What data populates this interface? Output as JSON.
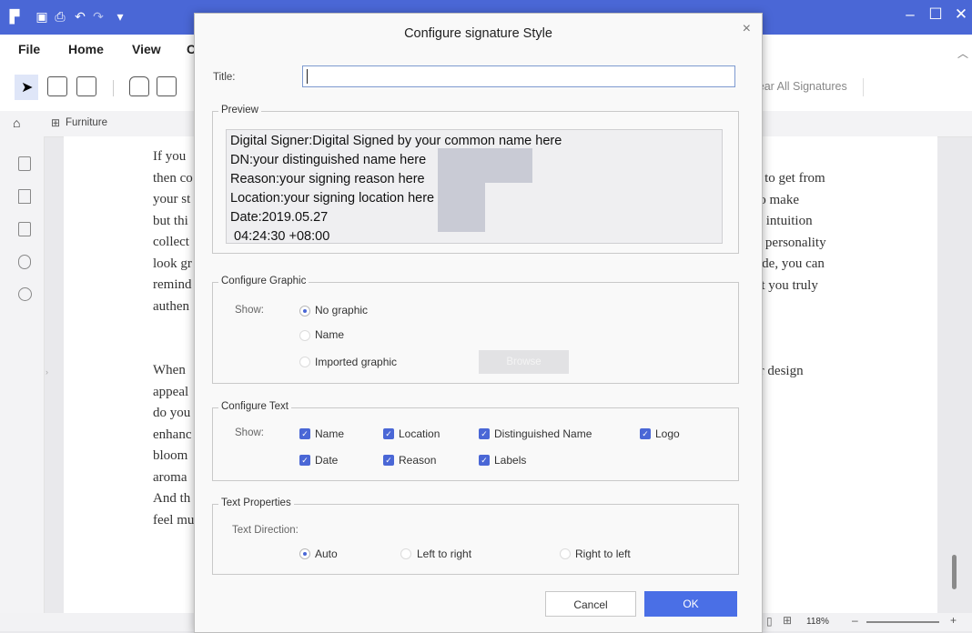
{
  "app": {
    "menu": [
      "File",
      "Home",
      "View",
      "C"
    ],
    "toolbar_right_label": "lear All Signatures",
    "tab_label": "Furniture",
    "zoom": "118%",
    "doc_left_lines": [
      "If you",
      "then co",
      "your st",
      "but thi",
      "collect",
      "look gr",
      "remind",
      "authen",
      "",
      "",
      "When",
      "appeal",
      "do you",
      "enhanc",
      "bloom",
      "aroma",
      "And th",
      "feel mu"
    ],
    "doc_right_lines": [
      "ant to get from",
      "it to make",
      "our intuition",
      "ing personality",
      "guide, you can",
      "that you truly",
      "",
      "",
      "",
      "rior design"
    ]
  },
  "dialog": {
    "title": "Configure signature Style",
    "close": "×",
    "title_field_label": "Title:",
    "title_value": "",
    "preview": {
      "legend": "Preview",
      "lines": [
        "Digital Signer:Digital Signed by your common name here",
        "DN:your distinguished name here",
        "Reason:your signing reason here",
        "Location:your signing location here",
        "Date:2019.05.27",
        " 04:24:30 +08:00"
      ]
    },
    "graphic": {
      "legend": "Configure Graphic",
      "show_label": "Show:",
      "options": [
        "No graphic",
        "Name",
        "Imported graphic"
      ],
      "selected": "No graphic",
      "browse": "Browse"
    },
    "text": {
      "legend": "Configure Text",
      "show_label": "Show:",
      "items": [
        {
          "label": "Name",
          "checked": true
        },
        {
          "label": "Location",
          "checked": true
        },
        {
          "label": "Distinguished Name",
          "checked": true
        },
        {
          "label": "Logo",
          "checked": true
        },
        {
          "label": "Date",
          "checked": true
        },
        {
          "label": "Reason",
          "checked": true
        },
        {
          "label": "Labels",
          "checked": true
        }
      ]
    },
    "properties": {
      "legend": "Text Properties",
      "direction_label": "Text Direction:",
      "options": [
        "Auto",
        "Left to right",
        "Right to left"
      ],
      "selected": "Auto"
    },
    "buttons": {
      "cancel": "Cancel",
      "ok": "OK"
    }
  }
}
